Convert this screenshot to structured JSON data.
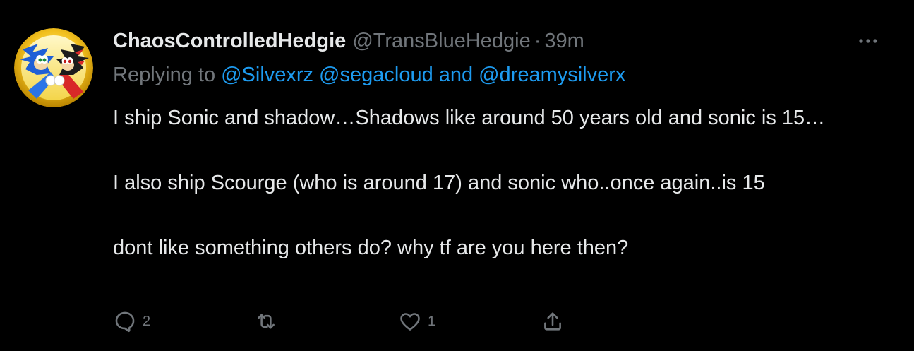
{
  "tweet": {
    "display_name": "ChaosControlledHedgie",
    "handle": "@TransBlueHedgie",
    "separator": "·",
    "time": "39m",
    "replying": {
      "prefix": "Replying to",
      "mention1": "@Silvexrz",
      "mention2": "@segacloud",
      "conjunction": "and",
      "mention3": "@dreamysilverx"
    },
    "paragraphs": [
      "I ship Sonic and shadow…Shadows like around 50 years old and sonic is 15…",
      "I also ship Scourge (who is around 17) and sonic who..once again..is 15",
      "dont like something others do? why tf are you here then?"
    ],
    "actions": {
      "reply_count": "2",
      "retweet_count": "",
      "like_count": "1"
    }
  },
  "icons": {
    "avatar": "sonic-shadow-avatar",
    "more": "more-dots-icon",
    "reply": "reply-icon",
    "retweet": "retweet-icon",
    "like": "heart-icon",
    "share": "share-icon"
  },
  "colors": {
    "background": "#000000",
    "text": "#e7e9ea",
    "secondary": "#71767b",
    "mention": "#1d9bf0"
  }
}
